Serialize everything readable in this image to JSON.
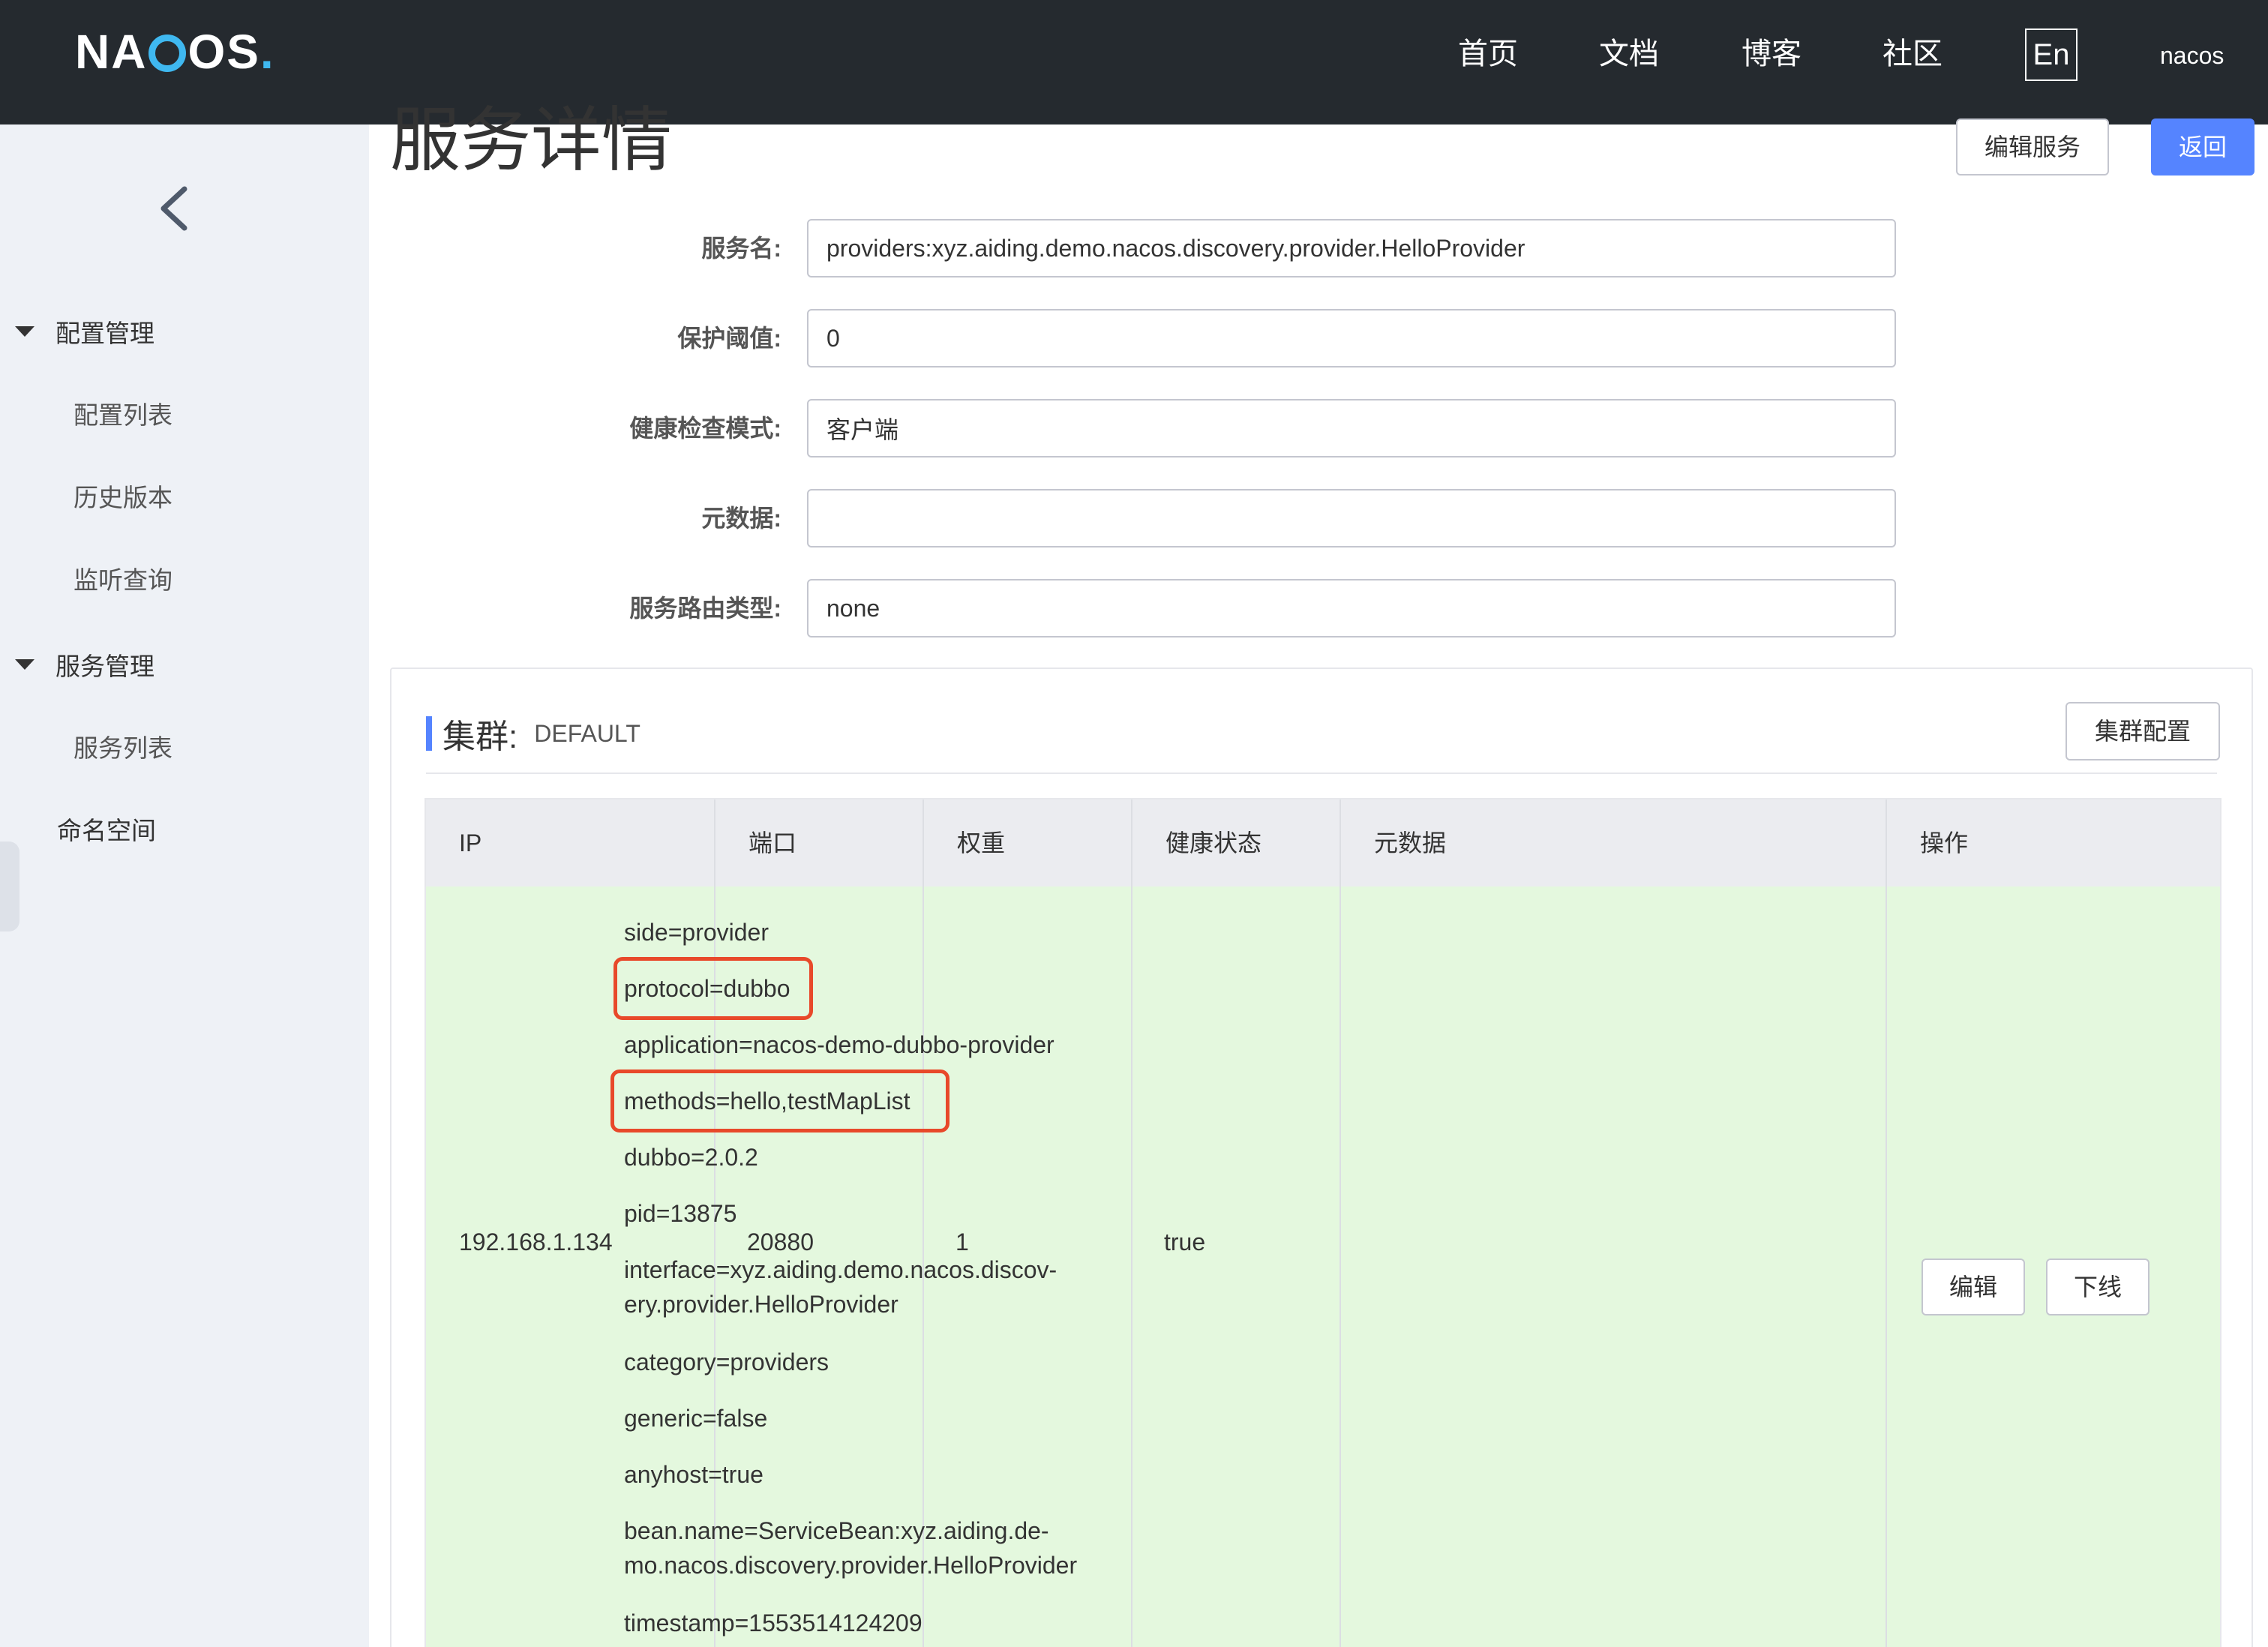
{
  "header": {
    "logo": {
      "part1": "NA",
      "part2": "OS",
      "part3": "."
    },
    "nav": [
      "首页",
      "文档",
      "博客",
      "社区"
    ],
    "lang": "En",
    "user": "nacos"
  },
  "sidebar": {
    "groups": [
      {
        "label": "配置管理",
        "items": [
          "配置列表",
          "历史版本",
          "监听查询"
        ]
      },
      {
        "label": "服务管理",
        "items": [
          "服务列表"
        ]
      }
    ],
    "namespace": "命名空间"
  },
  "page": {
    "title": "服务详情",
    "edit_service": "编辑服务",
    "back": "返回"
  },
  "form": {
    "service_name": {
      "label": "服务名:",
      "value": "providers:xyz.aiding.demo.nacos.discovery.provider.HelloProvider"
    },
    "protect_threshold": {
      "label": "保护阈值:",
      "value": "0"
    },
    "health_check_mode": {
      "label": "健康检查模式:",
      "value": "客户端"
    },
    "metadata": {
      "label": "元数据:",
      "value": ""
    },
    "route_type": {
      "label": "服务路由类型:",
      "value": "none"
    }
  },
  "cluster": {
    "label": "集群:",
    "name": "DEFAULT",
    "config_button": "集群配置",
    "columns": [
      "IP",
      "端口",
      "权重",
      "健康状态",
      "元数据",
      "操作"
    ],
    "rows": [
      {
        "ip": "192.168.1.134",
        "port": "20880",
        "weight": "1",
        "healthy": "true",
        "metadata": [
          "side=provider",
          "protocol=dubbo",
          "application=nacos-demo-dubbo-provider",
          "methods=hello,testMapList",
          "dubbo=2.0.2",
          "pid=13875",
          "interface=xyz.aiding.demo.nacos.discov-",
          "ery.provider.HelloProvider",
          "category=providers",
          "generic=false",
          "anyhost=true",
          "bean.name=ServiceBean:xyz.aiding.de-",
          "mo.nacos.discovery.provider.HelloProvider",
          "timestamp=1553514124209"
        ],
        "highlighted": [
          "protocol=dubbo",
          "methods=hello,testMapList"
        ],
        "actions": {
          "edit": "编辑",
          "offline": "下线"
        }
      }
    ]
  },
  "colors": {
    "header_bg": "#252a2f",
    "sidebar_bg": "#eef1f6",
    "primary": "#5584ff",
    "row_bg": "#e4f8de",
    "highlight_border": "#e8492a"
  },
  "icons": [
    "chevron-left-icon",
    "caret-down-icon"
  ]
}
